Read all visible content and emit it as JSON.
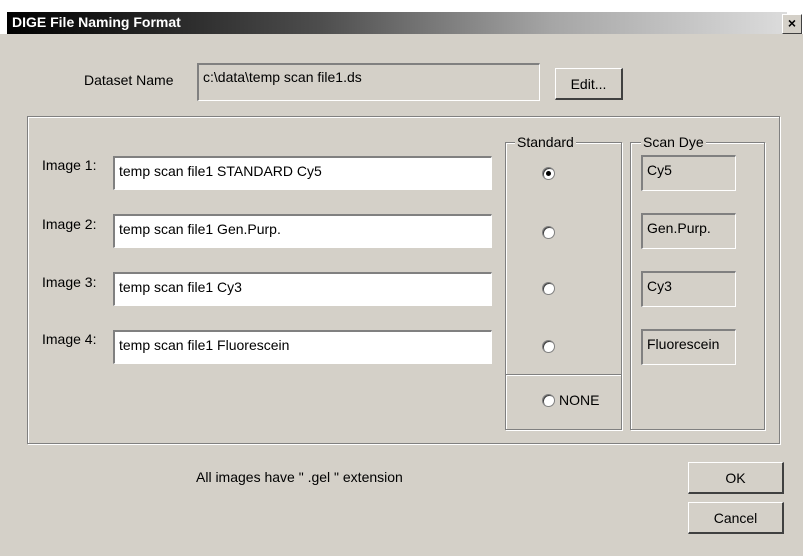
{
  "window": {
    "title": "DIGE File Naming Format",
    "close_glyph": "×"
  },
  "dataset": {
    "label": "Dataset Name",
    "value": "c:\\data\\temp scan file1.ds",
    "edit_label": "Edit..."
  },
  "images": [
    {
      "label": "Image 1:",
      "value": "temp scan file1 STANDARD Cy5",
      "standard_checked": true,
      "dye": "Cy5"
    },
    {
      "label": "Image 2:",
      "value": "temp scan file1 Gen.Purp.",
      "standard_checked": false,
      "dye": "Gen.Purp."
    },
    {
      "label": "Image 3:",
      "value": "temp scan file1 Cy3",
      "standard_checked": false,
      "dye": "Cy3"
    },
    {
      "label": "Image 4:",
      "value": "temp scan file1 Fluorescein",
      "standard_checked": false,
      "dye": "Fluorescein"
    }
  ],
  "standard_group": {
    "title": "Standard",
    "none_label": "NONE",
    "none_checked": false
  },
  "scan_dye_group": {
    "title": "Scan Dye"
  },
  "footer": {
    "note": "All images have \" .gel \" extension",
    "ok_label": "OK",
    "cancel_label": "Cancel"
  }
}
